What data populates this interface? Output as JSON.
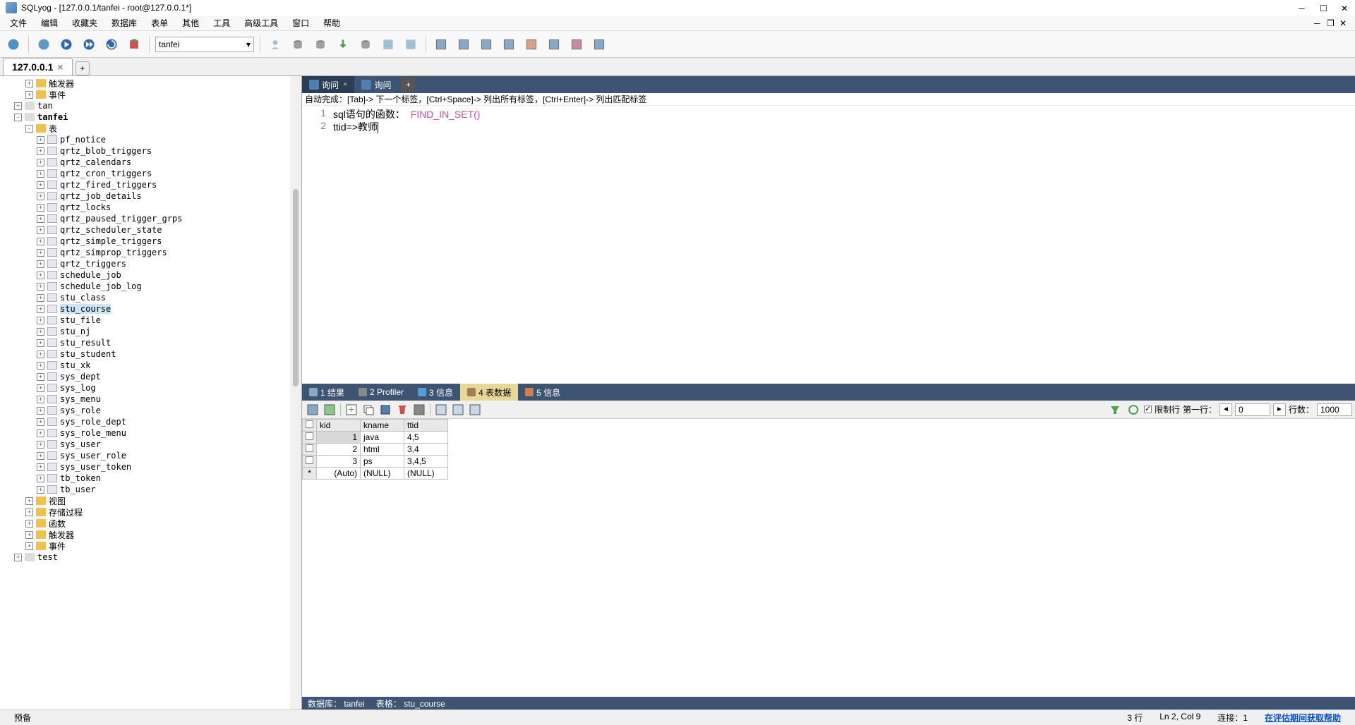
{
  "titlebar": {
    "title": "SQLyog - [127.0.0.1/tanfei - root@127.0.0.1*]"
  },
  "menubar": {
    "items": [
      "文件",
      "编辑",
      "收藏夹",
      "数据库",
      "表单",
      "其他",
      "工具",
      "高级工具",
      "窗口",
      "帮助"
    ]
  },
  "toolbar": {
    "db_selected": "tanfei"
  },
  "conn_tab": {
    "label": "127.0.0.1"
  },
  "tree": {
    "top": [
      {
        "icon": "folder",
        "label": "触发器",
        "indent": 2,
        "toggle": "+"
      },
      {
        "icon": "folder",
        "label": "事件",
        "indent": 2,
        "toggle": "+"
      },
      {
        "icon": "db",
        "label": "tan",
        "indent": 1,
        "toggle": "+"
      },
      {
        "icon": "db",
        "label": "tanfei",
        "indent": 1,
        "toggle": "-",
        "bold": true
      },
      {
        "icon": "folder",
        "label": "表",
        "indent": 2,
        "toggle": "-"
      }
    ],
    "tables": [
      "pf_notice",
      "qrtz_blob_triggers",
      "qrtz_calendars",
      "qrtz_cron_triggers",
      "qrtz_fired_triggers",
      "qrtz_job_details",
      "qrtz_locks",
      "qrtz_paused_trigger_grps",
      "qrtz_scheduler_state",
      "qrtz_simple_triggers",
      "qrtz_simprop_triggers",
      "qrtz_triggers",
      "schedule_job",
      "schedule_job_log",
      "stu_class",
      "stu_course",
      "stu_file",
      "stu_nj",
      "stu_result",
      "stu_student",
      "stu_xk",
      "sys_dept",
      "sys_log",
      "sys_menu",
      "sys_role",
      "sys_role_dept",
      "sys_role_menu",
      "sys_user",
      "sys_user_role",
      "sys_user_token",
      "tb_token",
      "tb_user"
    ],
    "selected_table": "stu_course",
    "bottom": [
      {
        "icon": "folder",
        "label": "视图",
        "indent": 2,
        "toggle": "+"
      },
      {
        "icon": "folder",
        "label": "存储过程",
        "indent": 2,
        "toggle": "+"
      },
      {
        "icon": "folder",
        "label": "函数",
        "indent": 2,
        "toggle": "+"
      },
      {
        "icon": "folder",
        "label": "触发器",
        "indent": 2,
        "toggle": "+"
      },
      {
        "icon": "folder",
        "label": "事件",
        "indent": 2,
        "toggle": "+"
      },
      {
        "icon": "db",
        "label": "test",
        "indent": 1,
        "toggle": "+"
      }
    ]
  },
  "query_tabs": {
    "tab1": "询问",
    "tab2": "询问"
  },
  "hint": "自动完成：[Tab]-> 下一个标签，[Ctrl+Space]-> 列出所有标签，[Ctrl+Enter]-> 列出匹配标签",
  "editor": {
    "line1_text": "sql语句的函数：  ",
    "line1_func": "FIND_IN_SET()",
    "line2": "ttid=>教师"
  },
  "result_tabs": {
    "t1": "1 结果",
    "t2": "2 Profiler",
    "t3": "3 信息",
    "t4": "4 表数据",
    "t5": "5 信息"
  },
  "result_toolbar": {
    "limit_label": "限制行",
    "first_row_label": "第一行：",
    "first_row_value": "0",
    "rowcount_label": "行数：",
    "rowcount_value": "1000"
  },
  "grid": {
    "headers": [
      "kid",
      "kname",
      "ttid"
    ],
    "rows": [
      {
        "kid": "1",
        "kname": "java",
        "ttid": "4,5",
        "selected": true
      },
      {
        "kid": "2",
        "kname": "html",
        "ttid": "3,4"
      },
      {
        "kid": "3",
        "kname": "ps",
        "ttid": "3,4,5"
      }
    ],
    "new_row": {
      "marker": "*",
      "kid": "(Auto)",
      "kname": "(NULL)",
      "ttid": "(NULL)"
    }
  },
  "result_status": {
    "db_label": "数据库：",
    "db_value": "tanfei",
    "table_label": "表格：",
    "table_value": "stu_course"
  },
  "statusbar": {
    "left": "预备",
    "rows": "3 行",
    "position": "Ln 2, Col 9",
    "connections": "连接：1",
    "help_link": "在评估期间获取帮助"
  }
}
